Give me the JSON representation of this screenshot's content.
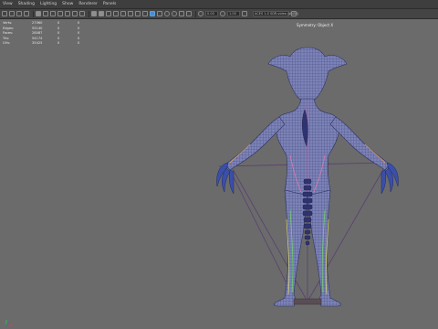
{
  "menu": [
    "View",
    "Shading",
    "Lighting",
    "Show",
    "Renderer",
    "Panels"
  ],
  "toolbar": {
    "value_a": "0.00",
    "value_b": "1.00",
    "color_field": "ACES 1.0 SDR-video (sRGB)"
  },
  "hud": {
    "rows": [
      {
        "label": "Verts:",
        "value": "27060",
        "col2": "0",
        "col3": "0"
      },
      {
        "label": "Edges:",
        "value": "55140",
        "col2": "0",
        "col3": "0"
      },
      {
        "label": "Faces:",
        "value": "28087",
        "col2": "0",
        "col3": "0"
      },
      {
        "label": "Tris:",
        "value": "54174",
        "col2": "0",
        "col3": "0"
      },
      {
        "label": "UVs:",
        "value": "35425",
        "col2": "0",
        "col3": "0"
      }
    ]
  },
  "viewport": {
    "object_label": "Symmetry: Object X",
    "background_color": "#6b6b6b",
    "mesh_color": "#7c83b8",
    "wire_color": "#3b3f6e",
    "skeleton_color": "#2f3470",
    "rig_line_color": "#5a3f73"
  }
}
